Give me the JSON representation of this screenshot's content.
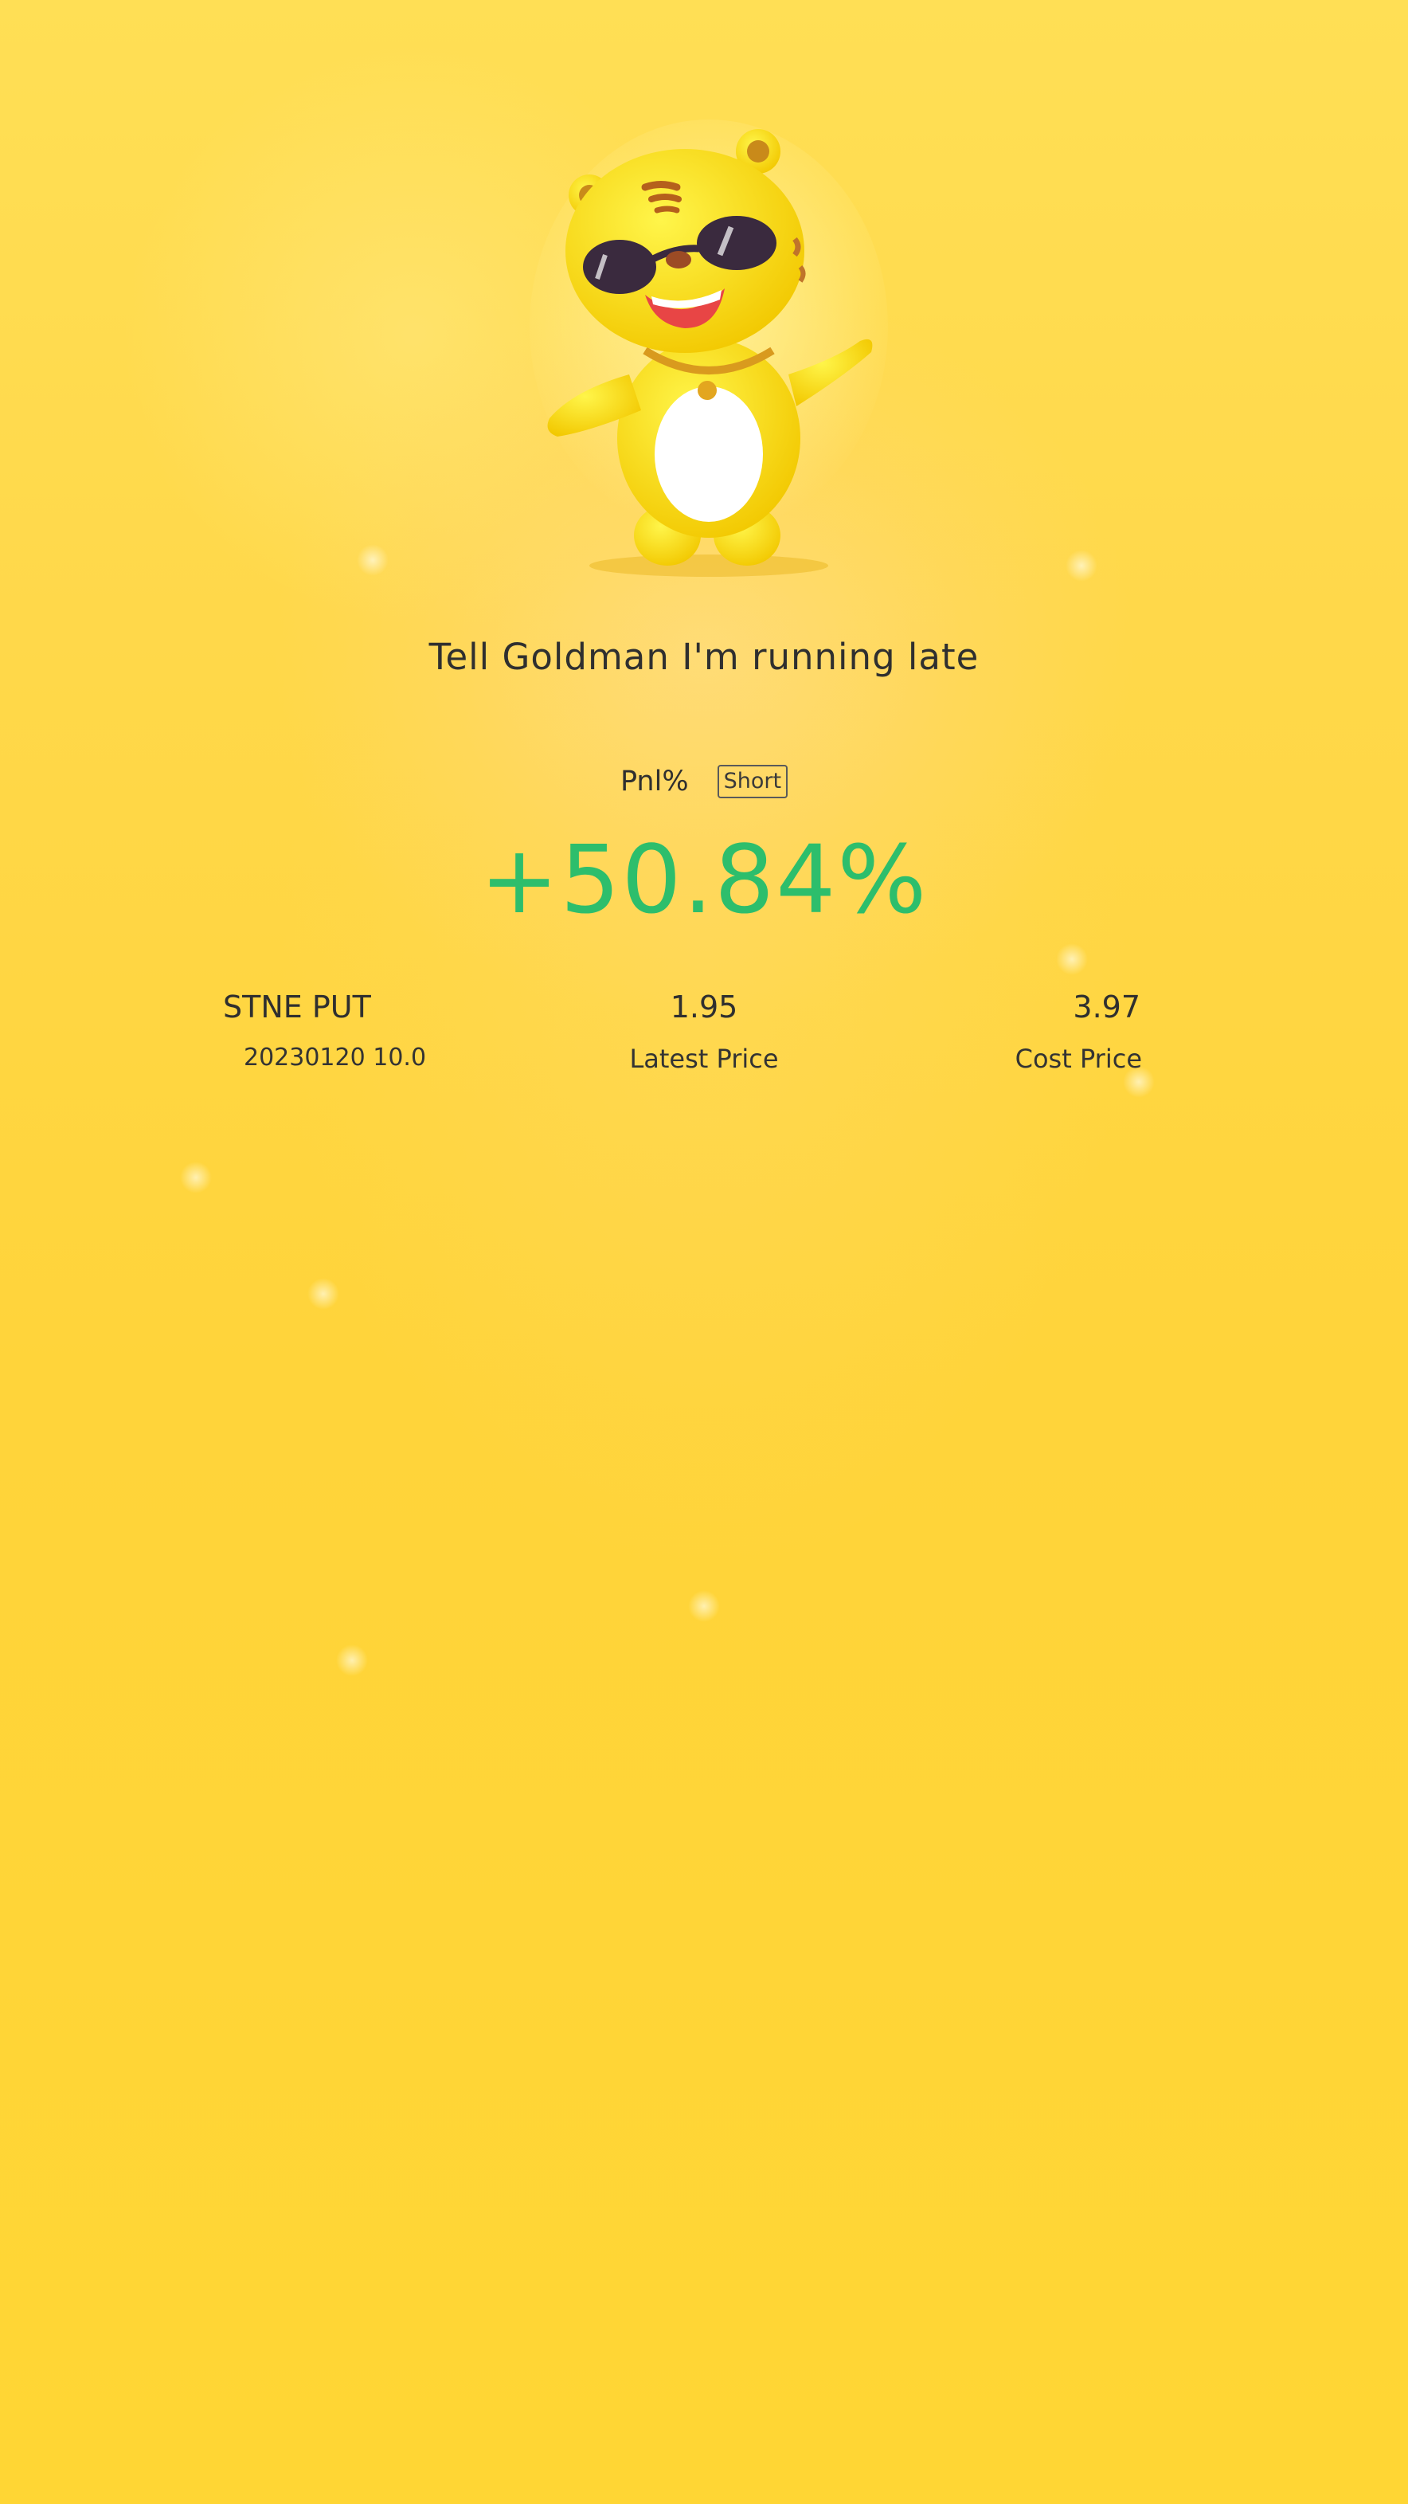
{
  "comment": "Tell Goldman I'm running late",
  "pnl": {
    "label": "Pnl%",
    "direction": "Short",
    "value": "+50.84%"
  },
  "position": {
    "ticker": "STNE PUT",
    "contract": "20230120 10.0",
    "latest_price": "1.95",
    "latest_price_label": "Latest Price",
    "cost_price": "3.97",
    "cost_price_label": "Cost Price"
  },
  "colors": {
    "background": "#ffd634",
    "gain": "#2dbe6c",
    "text": "#2f2f2f"
  },
  "icons": {
    "mascot": "tiger-mascot-with-sunglasses"
  }
}
